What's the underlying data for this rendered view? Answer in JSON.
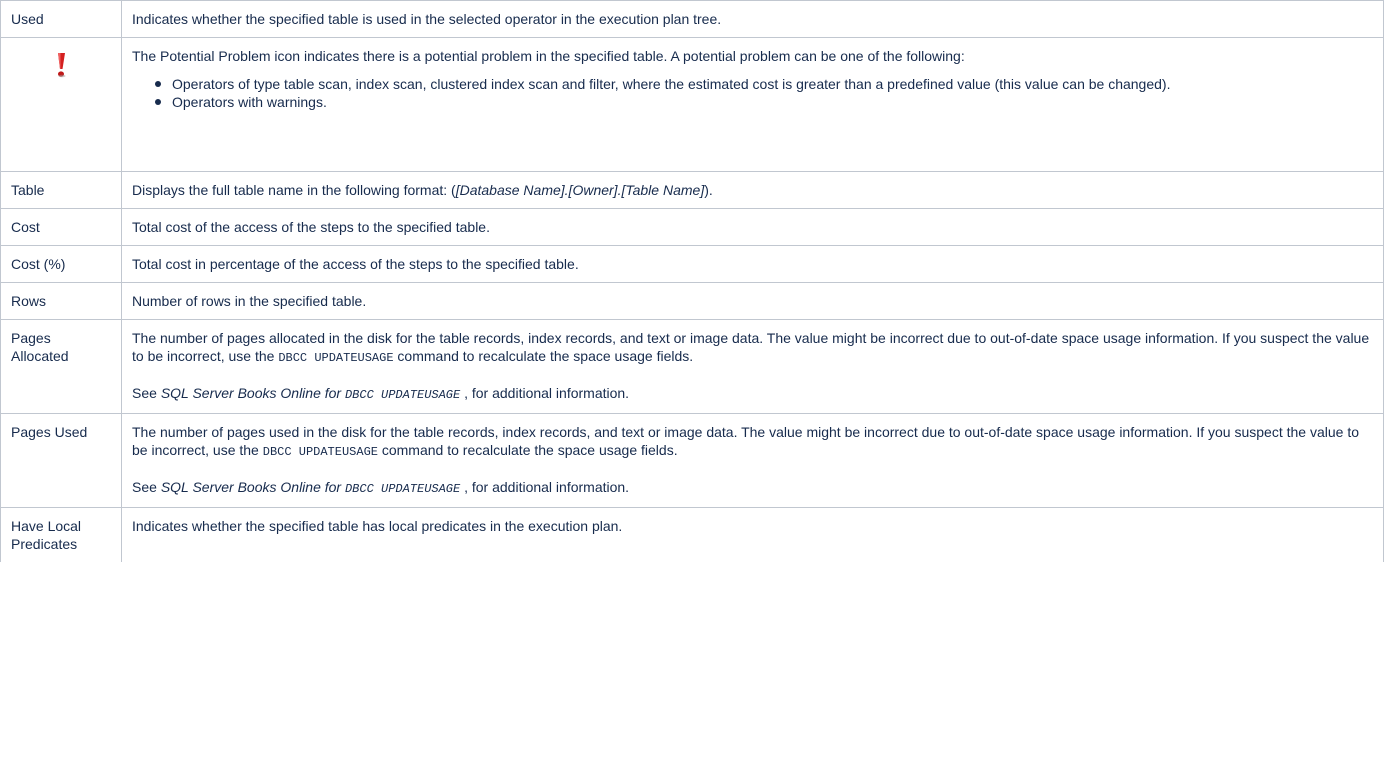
{
  "rows": [
    {
      "label": "Used",
      "text": "Indicates whether the specified table is used in the selected operator in the execution plan tree."
    },
    {
      "icon": "potential-problem-icon",
      "text": "The Potential Problem icon indicates there is a potential problem in the specified table. A potential problem can be one of the following:",
      "bullets": [
        "Operators of type table scan, index scan, clustered index scan and filter, where the estimated cost is greater than a predefined value (this value can be changed).",
        "Operators with warnings."
      ]
    },
    {
      "label": "Table",
      "text_pre": "Displays the full table name in the following format: (",
      "text_italic": "[Database Name].[Owner].[Table Name]",
      "text_post": ")."
    },
    {
      "label": "Cost",
      "text": "Total cost of the access of the steps to the specified table."
    },
    {
      "label": "Cost (%)",
      "text": "Total cost in percentage of the access of the steps to the specified table."
    },
    {
      "label": "Rows",
      "text": "Number of rows in the specified table."
    },
    {
      "label": "Pages Allocated",
      "p1_pre": "The number of pages allocated in the disk for the table records, index records, and text or image data. The value might be incorrect due to out-of-date space usage information. If you suspect the value to be incorrect, use the ",
      "p1_code": "DBCC UPDATEUSAGE",
      "p1_post": " command to recalculate the space usage fields.",
      "p2_pre": "See ",
      "p2_italic": "SQL Server Books Online for ",
      "p2_code": "DBCC UPDATEUSAGE",
      "p2_post": " , for additional information."
    },
    {
      "label": "Pages Used",
      "p1_pre": "The number of pages used in the disk for the table records, index records, and text or image data. The value might be incorrect due to out-of-date space usage information. If you suspect the value to be incorrect, use the ",
      "p1_code": "DBCC UPDATEUSAGE",
      "p1_post": " command to recalculate the space usage fields.",
      "p2_pre": "See ",
      "p2_italic": "SQL Server Books Online for ",
      "p2_code": "DBCC UPDATEUSAGE",
      "p2_post": " , for additional information."
    },
    {
      "label": "Have Local Predicates",
      "text": "Indicates whether the specified table has local predicates in the execution plan."
    }
  ]
}
